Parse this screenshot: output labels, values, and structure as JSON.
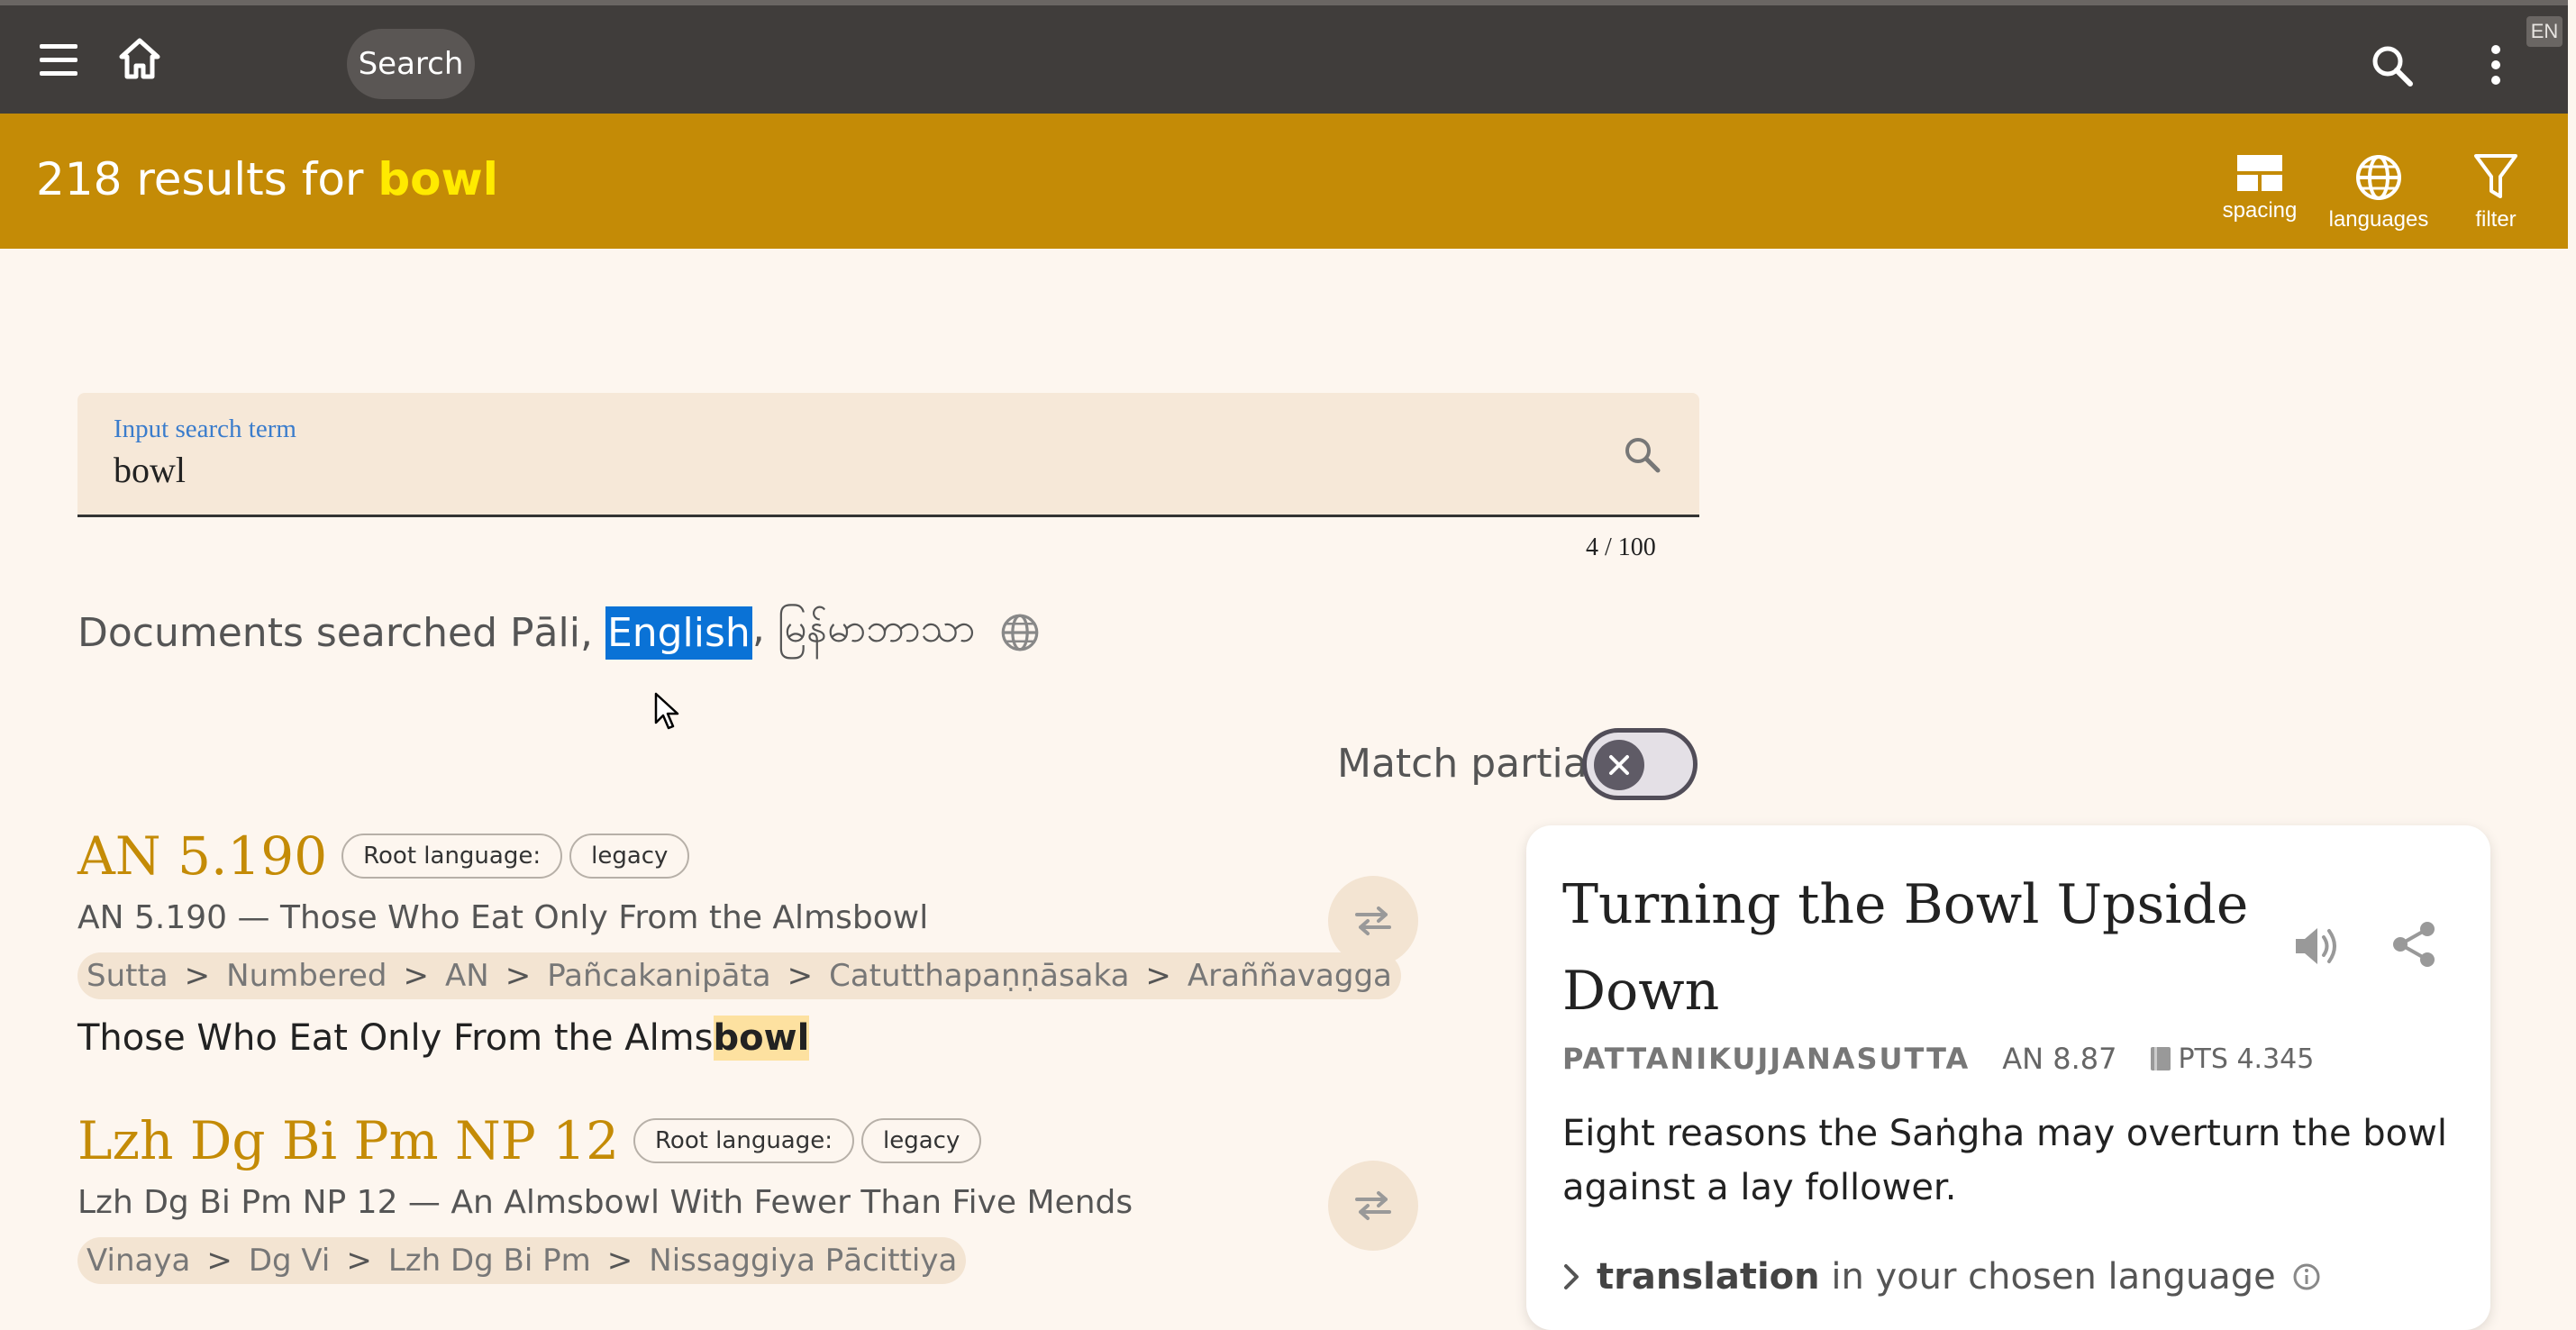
{
  "topbar": {
    "search_label": "Search",
    "language_badge": "EN",
    "icons": [
      "menu-icon",
      "home-icon",
      "search-icon",
      "more-vert-icon"
    ]
  },
  "results_bar": {
    "count_text": "218 results for",
    "term": "bowl",
    "tools": [
      {
        "label": "spacing",
        "icon": "spacing-icon"
      },
      {
        "label": "languages",
        "icon": "globe-icon"
      },
      {
        "label": "filter",
        "icon": "filter-icon"
      }
    ]
  },
  "search_field": {
    "label": "Input search term",
    "value": "bowl",
    "counter": "4 / 100"
  },
  "documents_searched": {
    "prefix": "Documents searched Pāli,",
    "highlighted": "English",
    "suffix": ", မြန်မာဘာသာ"
  },
  "match_partial": {
    "label": "Match partial",
    "enabled": false
  },
  "results": [
    {
      "title": "AN 5.190",
      "chips": [
        "Root language:",
        "legacy"
      ],
      "subtitle": "AN 5.190 — Those Who Eat Only From the Almsbowl",
      "breadcrumbs": [
        "Sutta",
        "Numbered",
        "AN",
        "Pañcakanipāta",
        "Catutthapaṇṇāsaka",
        "Araññavagga"
      ],
      "snippet_before": "Those Who Eat Only From the Alms",
      "snippet_highlight": "bowl"
    },
    {
      "title": "Lzh Dg Bi Pm NP 12",
      "chips": [
        "Root language:",
        "legacy"
      ],
      "subtitle": "Lzh Dg Bi Pm NP 12 — An Almsbowl With Fewer Than Five Mends",
      "breadcrumbs": [
        "Vinaya",
        "Dg Vi",
        "Lzh Dg Bi Pm",
        "Nissaggiya Pācittiya"
      ]
    }
  ],
  "card": {
    "title": "Turning the Bowl Upside Down",
    "pali_title": "PATTANIKUJJANASUTTA",
    "reference": "AN 8.87",
    "pts": "PTS 4.345",
    "blurb": "Eight reasons the Saṅgha may overturn the bowl against a lay follower.",
    "translation_bold": "translation",
    "translation_rest": " in your chosen language"
  },
  "colors": {
    "topbar": "#403d3b",
    "results_bar": "#c48b06",
    "term_highlight": "#ffea00",
    "accent_title": "#c48b06",
    "selection": "#0a72d6",
    "snippet_mark": "#fde1a0",
    "page_bg": "#fdf6ef"
  }
}
